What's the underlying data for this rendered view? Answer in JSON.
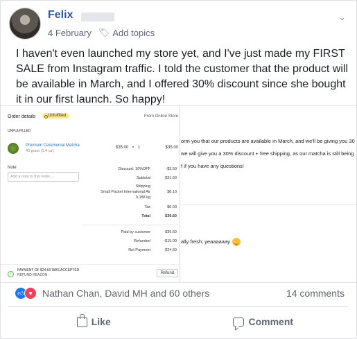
{
  "post": {
    "author": "Felix",
    "date": "4 February",
    "add_topics": "Add topics",
    "text": "I haven't even launched my store yet, and I've just made my FIRST SALE from Instagram traffic. I told the customer that the product will be available in March, and I offered 30% discount since she bought it in our first launch. So happy!",
    "icons": {
      "options": "chevron-down-icon",
      "topics": "tag-icon"
    }
  },
  "order": {
    "title": "Order details",
    "badge": "Unfulfilled",
    "from": "From Online Store",
    "status": "UNFULFILLED",
    "product_name": "Premium Ceremonial Matcha",
    "product_variant": "40 gram (1.4 oz)",
    "unit_price": "$35.00",
    "times": "×",
    "qty": "1",
    "line_total": "$35.00",
    "note_label": "Note",
    "note_placeholder": "Add a note to this order...",
    "discount_label": "Discount: 10%OFF",
    "discount_value": "-$3.50",
    "subtotal_label": "Subtotal",
    "subtotal_value": "$31.50",
    "shipping_label": "Shipping",
    "shipping_method": "Small Packet International Air",
    "shipping_weight": "0.188 kg",
    "shipping_value": "$8.10",
    "tax_label": "Tax",
    "tax_value": "$0.00",
    "total_label": "Total",
    "total_value": "$39.60",
    "paid_label": "Paid by customer",
    "paid_value": "$39.60",
    "refunded_label": "Refunded",
    "refunded_value": "-$15.00",
    "net_label": "Net Payment",
    "net_value": "$24.60",
    "payment_note": "PAYMENT OF $24.60 WAS ACCEPTED.",
    "refund_reason": "REFUND REASON:",
    "refund_button": "Refund"
  },
  "email": {
    "line1": "orm you that our products are available in March, and we'll be giving you 30",
    "line2": "we will give you a 30% discount + free shipping, as our matcha is still being",
    "line3": "f if you have any questions!",
    "reply": "ally fresh; yeaaaaaay"
  },
  "reactions": {
    "names": "Nathan Chan, David MH and 60 others",
    "comments": "14 comments",
    "icons": [
      "like-reaction-icon",
      "love-reaction-icon"
    ],
    "colors": {
      "like": "#1877f2",
      "love": "#f33e58"
    }
  },
  "actions": {
    "like": "Like",
    "comment": "Comment"
  }
}
